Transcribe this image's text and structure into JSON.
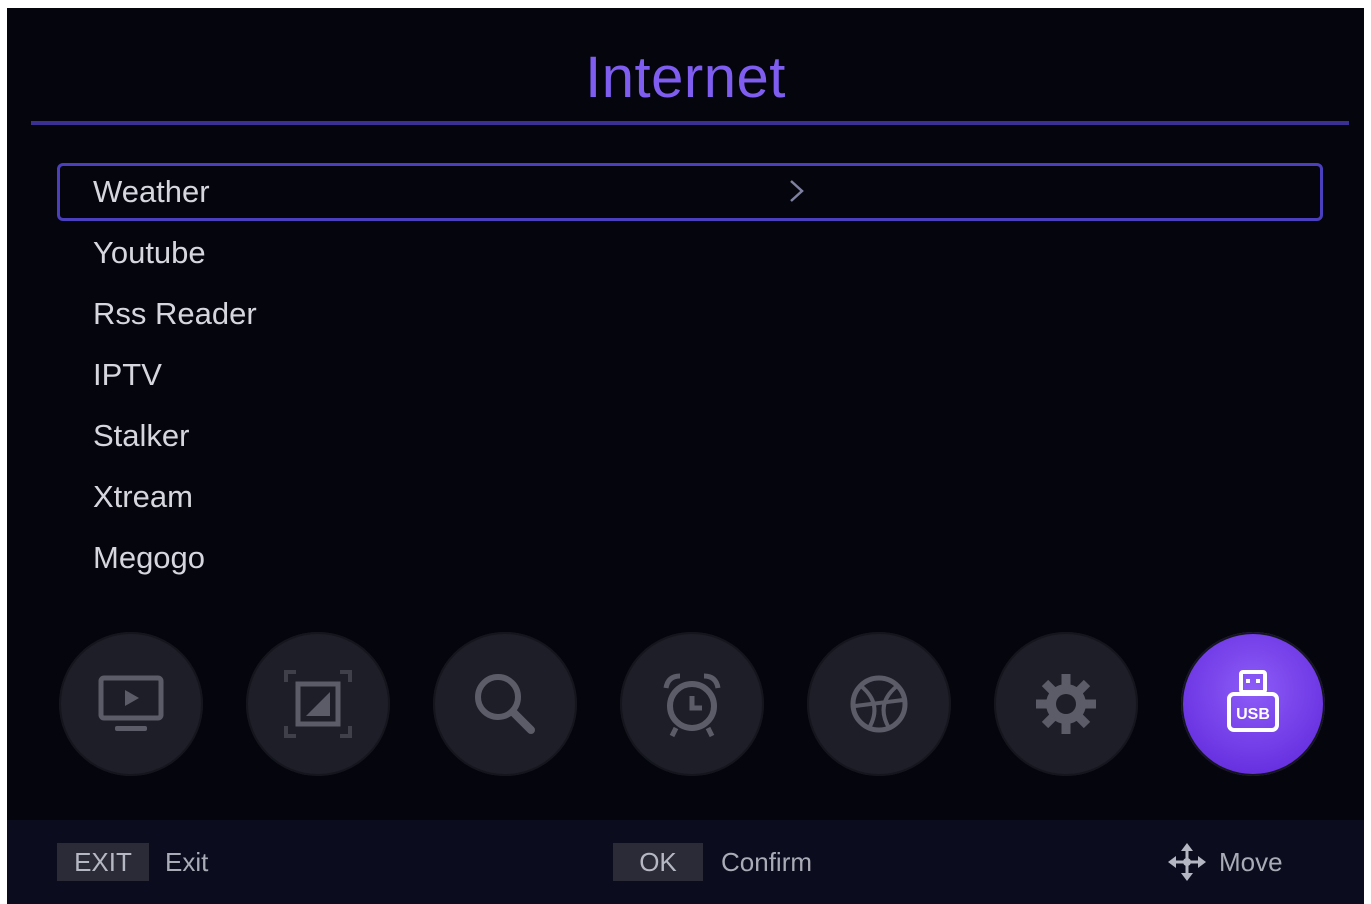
{
  "header": {
    "title": "Internet"
  },
  "menu": {
    "items": [
      {
        "label": "Weather"
      },
      {
        "label": "Youtube"
      },
      {
        "label": "Rss Reader"
      },
      {
        "label": "IPTV"
      },
      {
        "label": "Stalker"
      },
      {
        "label": "Xtream"
      },
      {
        "label": "Megogo"
      }
    ],
    "selected_label": "Weather"
  },
  "icon_bar": {
    "items": [
      "tv-icon",
      "picture-icon",
      "search-icon",
      "alarm-clock-icon",
      "globe-icon",
      "gear-icon",
      "usb-icon"
    ],
    "active": "usb-icon",
    "usb_text": "USB"
  },
  "footer": {
    "exit_key": "EXIT",
    "exit_label": "Exit",
    "ok_key": "OK",
    "ok_label": "Confirm",
    "move_label": "Move"
  },
  "colors": {
    "accent": "#7e5df0",
    "background": "#05060d",
    "active_icon": "#7b46ec"
  }
}
